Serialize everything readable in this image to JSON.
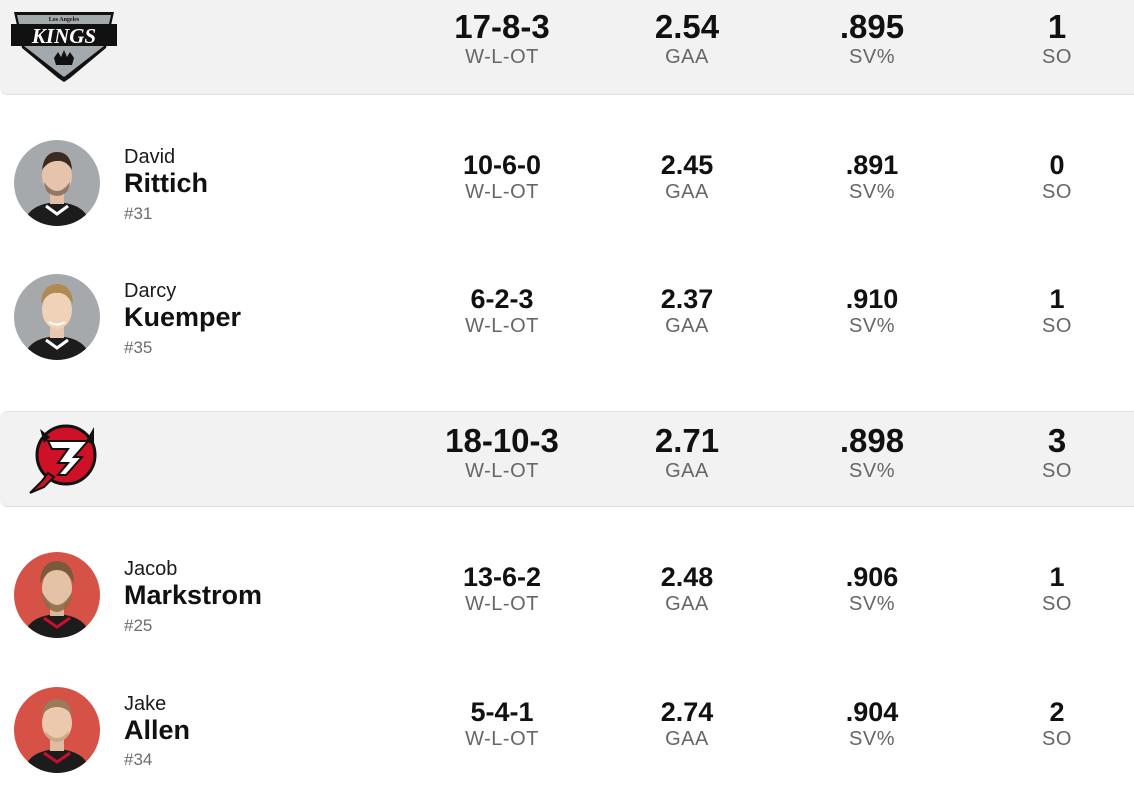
{
  "teams": [
    {
      "name": "kings",
      "logo_text_top": "Los Angeles",
      "logo_text_main": "KINGS",
      "stats": {
        "record": "17-8-3",
        "gaa": "2.54",
        "svpct": ".895",
        "so": "1"
      },
      "players": [
        {
          "first": "David",
          "last": "Rittich",
          "number": "#31",
          "record": "10-6-0",
          "gaa": "2.45",
          "svpct": ".891",
          "so": "0"
        },
        {
          "first": "Darcy",
          "last": "Kuemper",
          "number": "#35",
          "record": "6-2-3",
          "gaa": "2.37",
          "svpct": ".910",
          "so": "1"
        }
      ]
    },
    {
      "name": "devils",
      "stats": {
        "record": "18-10-3",
        "gaa": "2.71",
        "svpct": ".898",
        "so": "3"
      },
      "players": [
        {
          "first": "Jacob",
          "last": "Markstrom",
          "number": "#25",
          "record": "13-6-2",
          "gaa": "2.48",
          "svpct": ".906",
          "so": "1"
        },
        {
          "first": "Jake",
          "last": "Allen",
          "number": "#34",
          "record": "5-4-1",
          "gaa": "2.74",
          "svpct": ".904",
          "so": "2"
        }
      ]
    }
  ],
  "labels": {
    "record": "W-L-OT",
    "gaa": "GAA",
    "svpct": "SV%",
    "so": "SO"
  },
  "colors": {
    "kings_avatar_bg": "#a6a9ab",
    "devils_avatar_bg": "#d65247",
    "devils_red": "#ce1126"
  }
}
